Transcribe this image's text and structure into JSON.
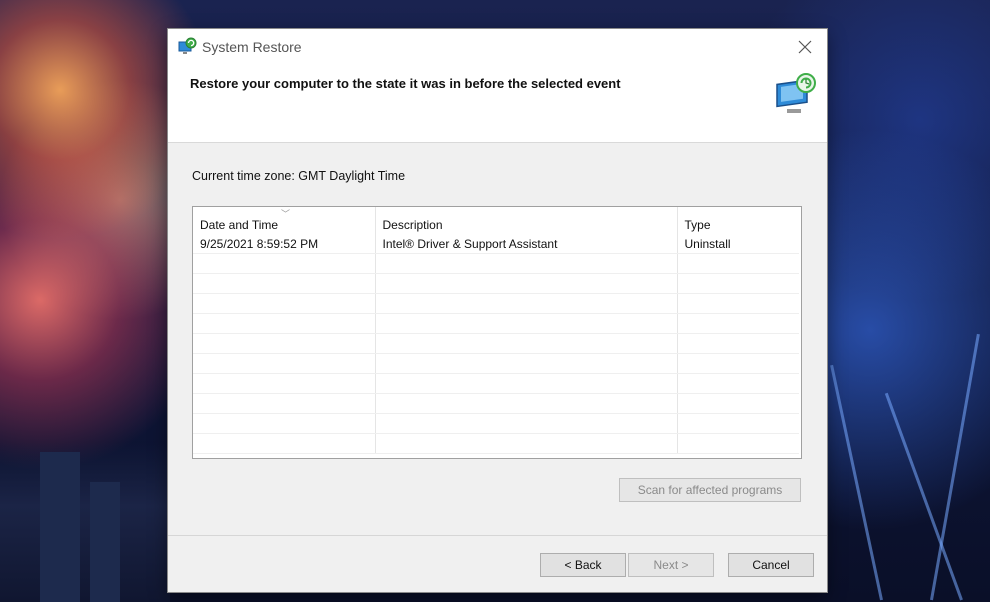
{
  "window": {
    "title": "System Restore",
    "heading": "Restore your computer to the state it was in before the selected event"
  },
  "timezone": {
    "text": "Current time zone: GMT Daylight Time"
  },
  "grid": {
    "headers": [
      "Date and Time",
      "Description",
      "Type"
    ],
    "sorted_column": "Date and Time",
    "rows": [
      {
        "date": "9/25/2021 8:59:52 PM",
        "description": "Intel® Driver & Support Assistant",
        "type": "Uninstall"
      }
    ]
  },
  "buttons": {
    "scan": "Scan for affected programs",
    "back": "< Back",
    "next": "Next >",
    "cancel": "Cancel"
  },
  "icons": {
    "title_icon": "system-restore-icon",
    "hero_icon": "restore-computer-icon",
    "close_icon": "close-icon"
  },
  "colors": {
    "accent": "#2e8bd8",
    "restore_green": "#3fae49"
  }
}
